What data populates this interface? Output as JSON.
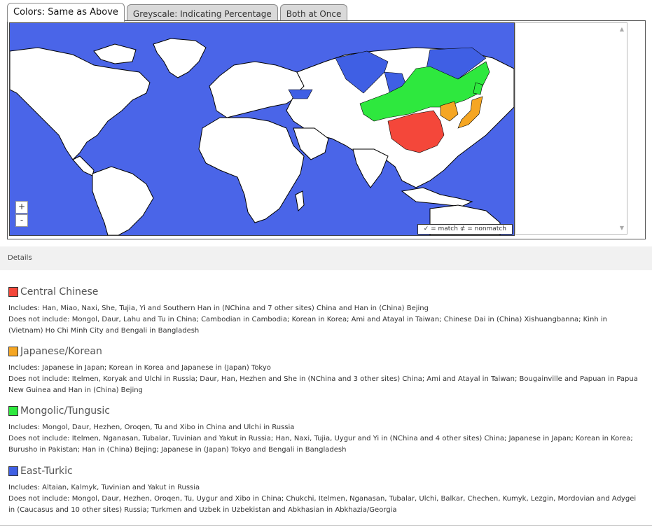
{
  "tabs": [
    {
      "label": "Colors: Same as Above",
      "active": true
    },
    {
      "label": "Greyscale: Indicating Percentage",
      "active": false
    },
    {
      "label": "Both at Once",
      "active": false
    }
  ],
  "map": {
    "zoom_in": "+",
    "zoom_out": "-",
    "legend": "✓ = match  ⊄ = nonmatch",
    "colors": {
      "ocean": "#4a65e8",
      "land": "#ffffff",
      "central_chinese": "#f4473a",
      "japanese_korean": "#f5a623",
      "mongolic_tungusic": "#2ee83e",
      "east_turkic": "#3f5fe4"
    }
  },
  "details": {
    "label": "Details",
    "groups": [
      {
        "name": "Central Chinese",
        "color": "#f4473a",
        "includes": "Includes: Han, Miao, Naxi, She, Tujia, Yi and Southern Han in (NChina and 7 other sites) China and Han in (China) Bejing",
        "excludes": "Does not include: Mongol, Daur, Lahu and Tu in China; Cambodian in Cambodia; Korean in Korea; Ami and Atayal in Taiwan; Chinese Dai in (China) Xishuangbanna; Kinh in (Vietnam) Ho Chi Minh City and Bengali in Bangladesh"
      },
      {
        "name": "Japanese/Korean",
        "color": "#f5a623",
        "includes": "Includes: Japanese in Japan; Korean in Korea and Japanese in (Japan) Tokyo",
        "excludes": "Does not include: Itelmen, Koryak and Ulchi in Russia; Daur, Han, Hezhen and She in (NChina and 3 other sites) China; Ami and Atayal in Taiwan; Bougainville and Papuan in Papua New Guinea and Han in (China) Bejing"
      },
      {
        "name": "Mongolic/Tungusic",
        "color": "#2ee83e",
        "includes": "Includes: Mongol, Daur, Hezhen, Oroqen, Tu and Xibo in China and Ulchi in Russia",
        "excludes": "Does not include: Itelmen, Nganasan, Tubalar, Tuvinian and Yakut in Russia; Han, Naxi, Tujia, Uygur and Yi in (NChina and 4 other sites) China; Japanese in Japan; Korean in Korea; Burusho in Pakistan; Han in (China) Bejing; Japanese in (Japan) Tokyo and Bengali in Bangladesh"
      },
      {
        "name": "East-Turkic",
        "color": "#3f5fe4",
        "includes": "Includes: Altaian, Kalmyk, Tuvinian and Yakut in Russia",
        "excludes": "Does not include: Mongol, Daur, Hezhen, Oroqen, Tu, Uygur and Xibo in China; Chukchi, Itelmen, Nganasan, Tubalar, Ulchi, Balkar, Chechen, Kumyk, Lezgin, Mordovian and Adygei in (Caucasus and 10 other sites) Russia; Turkmen and Uzbek in Uzbekistan and Abkhasian in Abkhazia/Georgia"
      }
    ]
  }
}
